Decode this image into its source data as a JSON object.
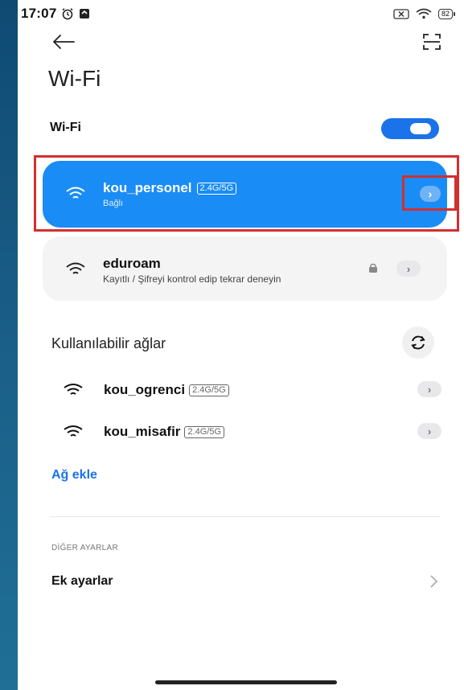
{
  "status_bar": {
    "time": "17:07",
    "battery": "82"
  },
  "header": {
    "title": "Wi-Fi"
  },
  "wifi_toggle": {
    "label": "Wi-Fi",
    "enabled": true
  },
  "connected_network": {
    "name": "kou_personel",
    "band": "2.4G/5G",
    "status": "Bağlı"
  },
  "saved_network": {
    "name": "eduroam",
    "status": "Kayıtlı / Şifreyi kontrol edip tekrar deneyin"
  },
  "available": {
    "header": "Kullanılabilir ağlar",
    "networks": [
      {
        "name": "kou_ogrenci",
        "band": "2.4G/5G"
      },
      {
        "name": "kou_misafir",
        "band": "2.4G/5G"
      }
    ]
  },
  "add_network_label": "Ağ ekle",
  "other_settings": {
    "section_label": "DİĞER AYARLAR",
    "extra_settings_label": "Ek ayarlar"
  },
  "icons": {
    "back": "back-arrow-icon",
    "scan": "scan-icon",
    "wifi": "wifi-icon",
    "lock": "lock-icon",
    "refresh": "refresh-icon",
    "chevron": "chevron-right-icon"
  },
  "colors": {
    "accent": "#1a8cf5",
    "toggle_on": "#1a73e8",
    "link": "#1a73e8",
    "highlight_box": "#d32f2f"
  }
}
